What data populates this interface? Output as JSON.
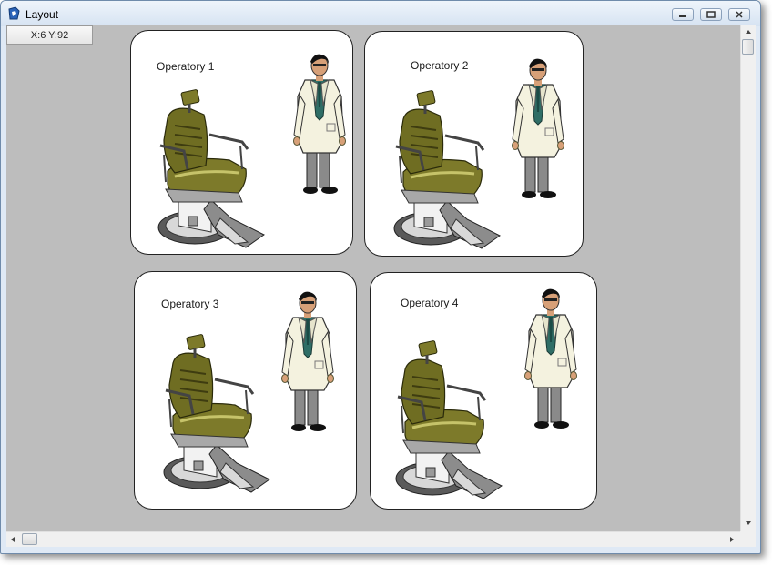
{
  "window": {
    "title": "Layout",
    "icon": "app-logo-icon",
    "controls": [
      "minimize-icon",
      "restore-icon",
      "close-icon"
    ]
  },
  "cursor_readout": "X:6 Y:92",
  "operatories": [
    {
      "label": "Operatory 1"
    },
    {
      "label": "Operatory 2"
    },
    {
      "label": "Operatory 3"
    },
    {
      "label": "Operatory 4"
    }
  ],
  "illustrations": {
    "chair": "dental-chair-icon",
    "person": "dentist-icon"
  },
  "colors": {
    "canvas": "#bdbdbd",
    "chair_upholstery": "#7d7a2a",
    "coat": "#f4f2df",
    "shirt": "#2f6e66"
  }
}
